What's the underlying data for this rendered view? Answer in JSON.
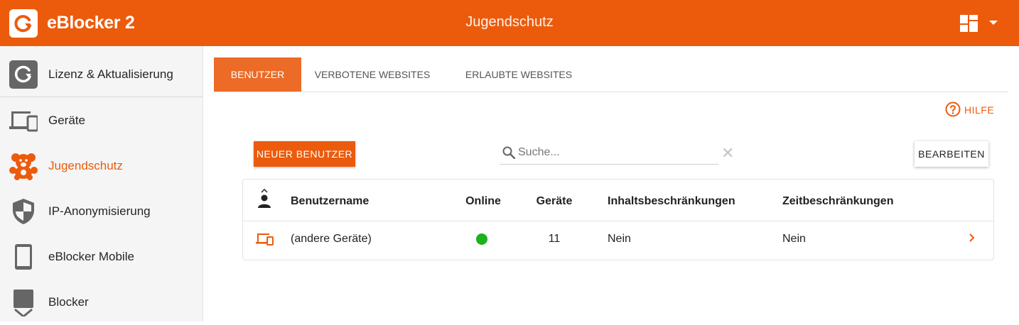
{
  "header": {
    "app_title": "eBlocker 2",
    "page_title": "Jugendschutz",
    "brand_color": "#ec5b0c"
  },
  "sidebar": {
    "items": [
      {
        "label": "Lizenz & Aktualisierung",
        "icon": "update-icon"
      },
      {
        "label": "Geräte",
        "icon": "devices-icon"
      },
      {
        "label": "Jugendschutz",
        "icon": "teddy-bear-icon",
        "active": true
      },
      {
        "label": "IP-Anonymisierung",
        "icon": "shield-icon"
      },
      {
        "label": "eBlocker Mobile",
        "icon": "mobile-icon"
      },
      {
        "label": "Blocker",
        "icon": "blocker-icon"
      }
    ]
  },
  "tabs": [
    {
      "label": "BENUTZER",
      "active": true
    },
    {
      "label": "VERBOTENE WEBSITES"
    },
    {
      "label": "ERLAUBTE WEBSITES"
    }
  ],
  "help_label": "HILFE",
  "toolbar": {
    "new_user_label": "NEUER BENUTZER",
    "search_placeholder": "Suche...",
    "edit_label": "BEARBEITEN"
  },
  "table": {
    "columns": [
      "Benutzername",
      "Online",
      "Geräte",
      "Inhaltsbeschränkungen",
      "Zeitbeschränkungen"
    ],
    "rows": [
      {
        "name": "(andere Geräte)",
        "online": true,
        "online_color": "#1cb21c",
        "devices": "11",
        "content": "Nein",
        "time": "Nein"
      }
    ]
  }
}
